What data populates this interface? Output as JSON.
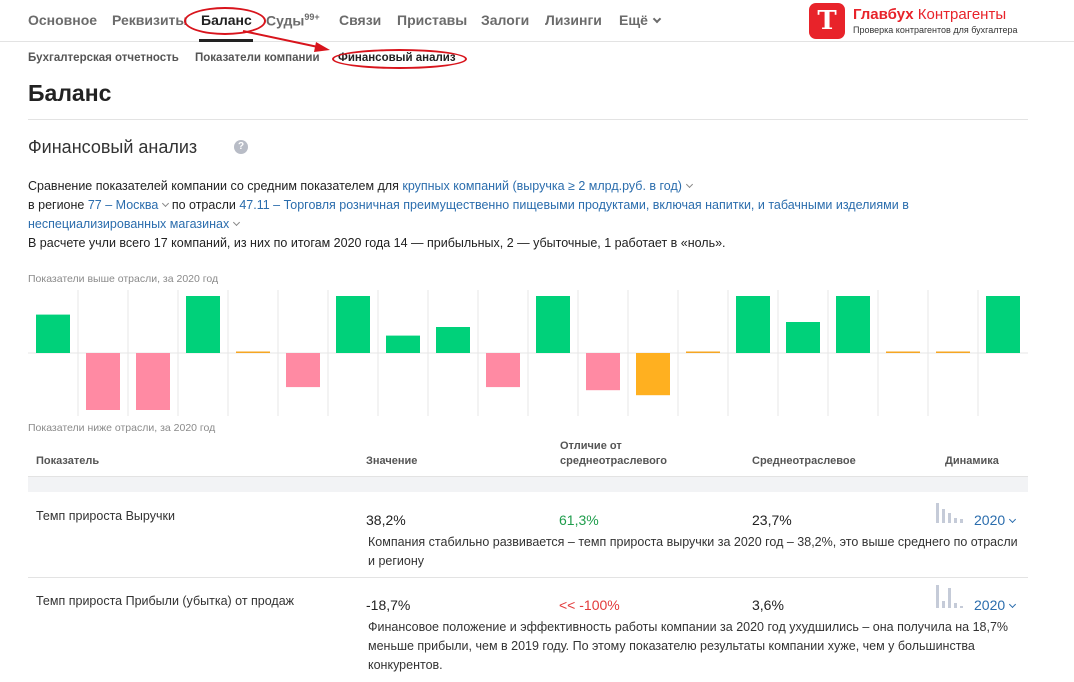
{
  "nav": {
    "items": [
      "Основное",
      "Реквизиты",
      "Баланс",
      "Суды",
      "Связи",
      "Приставы",
      "Залоги",
      "Лизинги",
      "Ещё"
    ],
    "courts_badge": "99+"
  },
  "brand": {
    "name_bold": "Главбух",
    "name_rest": "Контрагенты",
    "tagline": "Проверка контрагентов для бухгалтера",
    "logo_letter": "Т",
    "color": "#e8232a"
  },
  "subnav": {
    "items": [
      "Бухгалтерская отчетность",
      "Показатели компании",
      "Финансовый анализ"
    ]
  },
  "page": {
    "title": "Баланс"
  },
  "section": {
    "title": "Финансовый анализ",
    "help": "?"
  },
  "description": {
    "line1_prefix": "Сравнение показателей компании со средним показателем для",
    "line1_link": "крупных компаний (выручка ≥ 2 млрд.руб. в год)",
    "line2_prefix": "в регионе",
    "region_link": "77 – Москва",
    "line2_mid": "по отрасли",
    "industry_link": "47.11 – Торговля розничная преимущественно пищевыми продуктами, включая напитки, и табачными изделиями в",
    "industry_link_cont": "неспециализированных магазинах",
    "line4": "В расчете учли всего 17 компаний, из них по итогам 2020 года 14 — прибыльных, 2 — убыточные, 1 работает в «ноль»."
  },
  "chart_labels": {
    "above": "Показатели выше отрасли, за 2020 год",
    "below": "Показатели ниже отрасли, за 2020 год"
  },
  "chart_data": {
    "type": "bar",
    "values": [
      0.62,
      -0.92,
      -0.92,
      0.92,
      0.02,
      -0.55,
      0.92,
      0.28,
      0.42,
      -0.55,
      0.92,
      -0.6,
      -0.68,
      0.02,
      0.92,
      0.5,
      0.92,
      0.02,
      0.02,
      0.92
    ],
    "statuses": [
      "above",
      "below",
      "below",
      "above",
      "neutral",
      "below",
      "above",
      "above",
      "above",
      "below",
      "above",
      "below",
      "warning",
      "neutral",
      "above",
      "above",
      "above",
      "neutral",
      "neutral",
      "above"
    ],
    "colors": {
      "above": "#00d17a",
      "below": "#ff8aa3",
      "warning": "#ffb020",
      "neutral": "#f5a623",
      "grid": "#e7e7e7"
    },
    "ylim": [
      -1,
      1
    ]
  },
  "table": {
    "headers": {
      "indicator": "Показатель",
      "value": "Значение",
      "diff": "Отличие от среднеотраслевого",
      "avg": "Среднеотраслевое",
      "dynamics": "Динамика"
    },
    "rows": [
      {
        "name": "Темп прироста Выручки",
        "value": "38,2%",
        "diff": "61,3%",
        "avg": "23,7%",
        "year": "2020",
        "spark": [
          0.85,
          0.6,
          0.4,
          0.2,
          0.15
        ],
        "note": "Компания стабильно развивается – темп прироста выручки за 2020 год – 38,2%, это выше среднего по отрасли и региону"
      },
      {
        "name": "Темп прироста Прибыли (убытка) от продаж",
        "value": "-18,7%",
        "diff": "<< -100%",
        "avg": "3,6%",
        "year": "2020",
        "spark": [
          0.95,
          0.3,
          0.85,
          0.2,
          0.1
        ],
        "note": "Финансовое положение и эффективность работы компании за 2020 год ухудшились – она получила на 18,7% меньше прибыли, чем в 2019 году. По этому показателю результаты компании хуже, чем у большинства конкурентов."
      }
    ]
  }
}
